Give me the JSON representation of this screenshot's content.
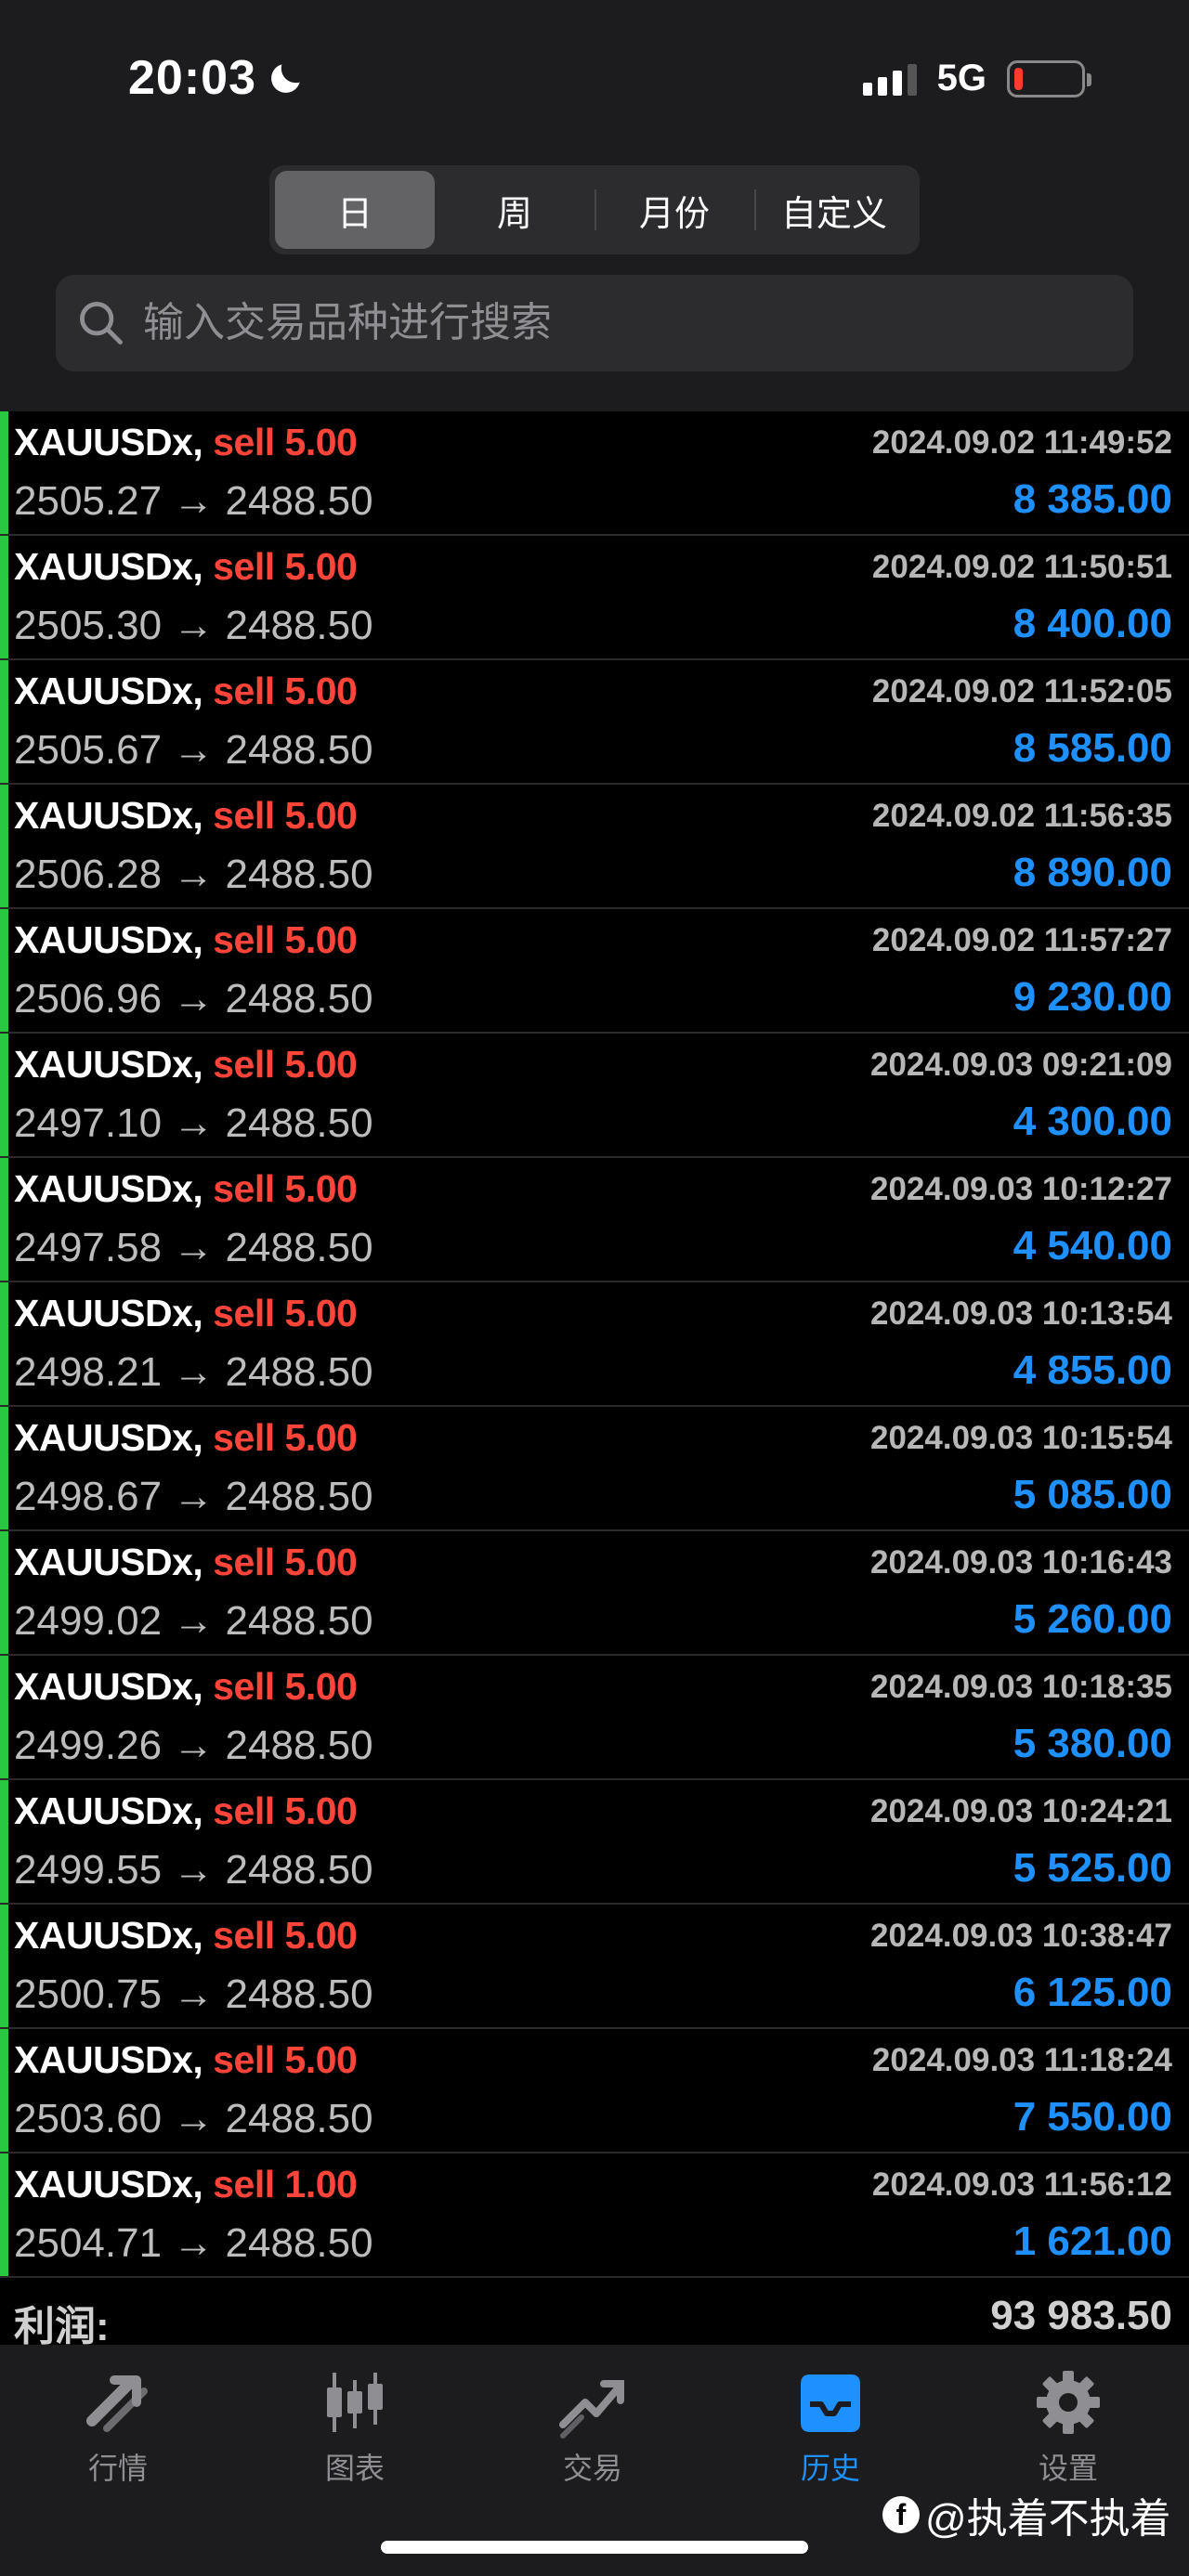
{
  "status_bar": {
    "time": "20:03",
    "network": "5G"
  },
  "period_tabs": [
    {
      "label": "日",
      "selected": true
    },
    {
      "label": "周",
      "selected": false
    },
    {
      "label": "月份",
      "selected": false
    },
    {
      "label": "自定义",
      "selected": false
    }
  ],
  "search": {
    "placeholder": "输入交易品种进行搜索"
  },
  "trades": [
    {
      "symbol": "XAUUSDx,",
      "side": "sell 5.00",
      "datetime": "2024.09.02 11:49:52",
      "prices": "2505.27 → 2488.50",
      "profit": "8 385.00"
    },
    {
      "symbol": "XAUUSDx,",
      "side": "sell 5.00",
      "datetime": "2024.09.02 11:50:51",
      "prices": "2505.30 → 2488.50",
      "profit": "8 400.00"
    },
    {
      "symbol": "XAUUSDx,",
      "side": "sell 5.00",
      "datetime": "2024.09.02 11:52:05",
      "prices": "2505.67 → 2488.50",
      "profit": "8 585.00"
    },
    {
      "symbol": "XAUUSDx,",
      "side": "sell 5.00",
      "datetime": "2024.09.02 11:56:35",
      "prices": "2506.28 → 2488.50",
      "profit": "8 890.00"
    },
    {
      "symbol": "XAUUSDx,",
      "side": "sell 5.00",
      "datetime": "2024.09.02 11:57:27",
      "prices": "2506.96 → 2488.50",
      "profit": "9 230.00"
    },
    {
      "symbol": "XAUUSDx,",
      "side": "sell 5.00",
      "datetime": "2024.09.03 09:21:09",
      "prices": "2497.10 → 2488.50",
      "profit": "4 300.00"
    },
    {
      "symbol": "XAUUSDx,",
      "side": "sell 5.00",
      "datetime": "2024.09.03 10:12:27",
      "prices": "2497.58 → 2488.50",
      "profit": "4 540.00"
    },
    {
      "symbol": "XAUUSDx,",
      "side": "sell 5.00",
      "datetime": "2024.09.03 10:13:54",
      "prices": "2498.21 → 2488.50",
      "profit": "4 855.00"
    },
    {
      "symbol": "XAUUSDx,",
      "side": "sell 5.00",
      "datetime": "2024.09.03 10:15:54",
      "prices": "2498.67 → 2488.50",
      "profit": "5 085.00"
    },
    {
      "symbol": "XAUUSDx,",
      "side": "sell 5.00",
      "datetime": "2024.09.03 10:16:43",
      "prices": "2499.02 → 2488.50",
      "profit": "5 260.00"
    },
    {
      "symbol": "XAUUSDx,",
      "side": "sell 5.00",
      "datetime": "2024.09.03 10:18:35",
      "prices": "2499.26 → 2488.50",
      "profit": "5 380.00"
    },
    {
      "symbol": "XAUUSDx,",
      "side": "sell 5.00",
      "datetime": "2024.09.03 10:24:21",
      "prices": "2499.55 → 2488.50",
      "profit": "5 525.00"
    },
    {
      "symbol": "XAUUSDx,",
      "side": "sell 5.00",
      "datetime": "2024.09.03 10:38:47",
      "prices": "2500.75 → 2488.50",
      "profit": "6 125.00"
    },
    {
      "symbol": "XAUUSDx,",
      "side": "sell 5.00",
      "datetime": "2024.09.03 11:18:24",
      "prices": "2503.60 → 2488.50",
      "profit": "7 550.00"
    },
    {
      "symbol": "XAUUSDx,",
      "side": "sell 1.00",
      "datetime": "2024.09.03 11:56:12",
      "prices": "2504.71 → 2488.50",
      "profit": "1 621.00"
    }
  ],
  "summary": {
    "label": "利润:",
    "value": "93 983.50"
  },
  "tabbar": [
    {
      "label": "行情",
      "icon": "quotes-icon",
      "active": false
    },
    {
      "label": "图表",
      "icon": "candlestick-chart-icon",
      "active": false
    },
    {
      "label": "交易",
      "icon": "trade-trend-icon",
      "active": false
    },
    {
      "label": "历史",
      "icon": "history-inbox-icon",
      "active": true
    },
    {
      "label": "设置",
      "icon": "gear-icon",
      "active": false
    }
  ],
  "watermark": {
    "text": "@执着不执着"
  },
  "colors": {
    "sell": "#ff453a",
    "profit": "#1e90ff",
    "indicator": "#28c840",
    "active_tab": "#1e90ff"
  }
}
